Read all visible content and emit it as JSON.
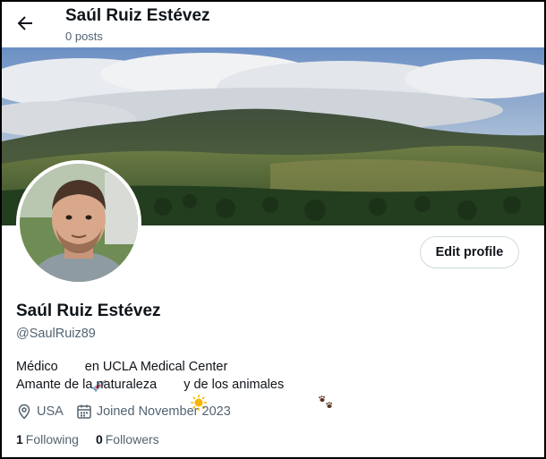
{
  "header": {
    "name": "Saúl Ruiz Estévez",
    "posts": "0 posts"
  },
  "profile": {
    "name": "Saúl Ruiz Estévez",
    "handle": "@SaulRuiz89",
    "edit_button": "Edit profile",
    "bio": {
      "line1_before": "Médico",
      "line1_after": "en UCLA Medical Center",
      "line2_before": "Amante de la naturaleza",
      "line2_after": "y de los animales"
    },
    "location": "USA",
    "joined": "Joined November 2023",
    "following_count": "1",
    "following_label": "Following",
    "followers_count": "0",
    "followers_label": "Followers"
  },
  "icons": {
    "back": "back-arrow-icon",
    "syringe": "syringe-emoji",
    "sun": "sun-emoji",
    "paws": "paw-prints-emoji",
    "location": "location-pin-icon",
    "calendar": "calendar-icon"
  },
  "colors": {
    "secondary_text": "#536471",
    "primary_text": "#0f1419",
    "button_border": "#cfd9de"
  }
}
